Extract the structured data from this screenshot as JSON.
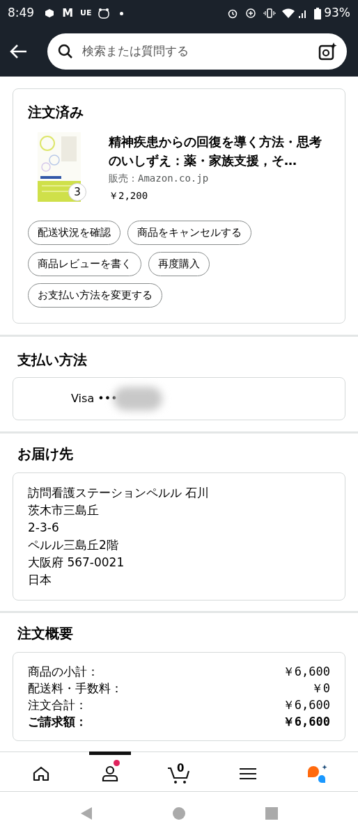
{
  "status_bar": {
    "time": "8:49",
    "notification_text": [
      "M",
      "UE"
    ],
    "battery": "93%"
  },
  "search": {
    "placeholder": "検索または質問する"
  },
  "order": {
    "title": "注文済み",
    "item": {
      "title": "精神疾患からの回復を導く方法・思考のいしずえ：薬・家族支援，そ…",
      "seller": "販売：Amazon.co.jp",
      "price": "￥2,200",
      "quantity": "3"
    },
    "buttons": [
      "配送状況を確認",
      "商品をキャンセルする",
      "商品レビューを書く",
      "再度購入",
      "お支払い方法を変更する"
    ]
  },
  "payment": {
    "title": "支払い方法",
    "method": "Visa •••"
  },
  "shipping": {
    "title": "お届け先",
    "lines": [
      "訪問看護ステーションペルル 石川",
      "茨木市三島丘",
      "2-3-6",
      "ペルル三島丘2階",
      "大阪府 567-0021",
      "日本"
    ]
  },
  "summary": {
    "title": "注文概要",
    "rows": [
      {
        "label": "商品の小計：",
        "value": "￥6,600",
        "emphasis": false
      },
      {
        "label": "配送料・手数料：",
        "value": "￥0",
        "emphasis": false
      },
      {
        "label": "注文合計：",
        "value": "￥6,600",
        "emphasis": false
      },
      {
        "label": "ご請求額：",
        "value": "￥6,600",
        "emphasis": true
      }
    ]
  },
  "bottom_nav": [
    {
      "kind": "home",
      "selected": false
    },
    {
      "kind": "account",
      "selected": true,
      "badge": true
    },
    {
      "kind": "cart",
      "selected": false,
      "count": "0"
    },
    {
      "kind": "menu",
      "selected": false
    },
    {
      "kind": "assistant",
      "selected": false
    }
  ]
}
